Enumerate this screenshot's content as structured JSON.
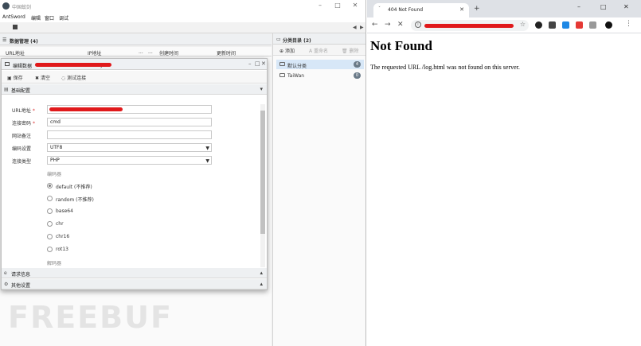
{
  "antsword": {
    "window_title": "中国蚁剑",
    "menu": [
      "AntSword",
      "编辑",
      "窗口",
      "调试"
    ],
    "data_panel_title": "数据管理 (4)",
    "columns": [
      "URL地址",
      "IP地址",
      "...",
      "...",
      "创建时间",
      "更新时间"
    ],
    "category_panel_title": "分类目录 (2)",
    "category_toolbar": {
      "add": "添加",
      "rename": "重命名",
      "delete": "删除"
    },
    "categories": [
      {
        "label": "默认分类",
        "count": "4"
      },
      {
        "label": "TaiWan",
        "count": "0"
      }
    ]
  },
  "dialog": {
    "title": "编辑数据",
    "title_suffix": ")",
    "toolbar": {
      "save": "保存",
      "clear": "清空",
      "test": "测试连接"
    },
    "sections": {
      "basic": "基础配置",
      "request": "请求信息",
      "other": "其他设置"
    },
    "form": {
      "url_label": "URL地址",
      "password_label": "连接密码",
      "password_value": "cmd",
      "note_label": "网站备注",
      "note_value": "",
      "encoding_label": "编码设置",
      "encoding_value": "UTF8",
      "type_label": "连接类型",
      "type_value": "PHP",
      "encoder_group_label": "编码器",
      "encoders": [
        "default (不推荐)",
        "random (不推荐)",
        "base64",
        "chr",
        "chr16",
        "rot13"
      ],
      "decoder_group_label": "解码器"
    }
  },
  "browser": {
    "tab_title": "404 Not Found",
    "heading": "Not Found",
    "message": "The requested URL /log.html was not found on this server."
  },
  "watermark": "FREEBUF",
  "colors": {
    "redaction": "#e0191b",
    "selected_category": "#d7e7f7"
  }
}
